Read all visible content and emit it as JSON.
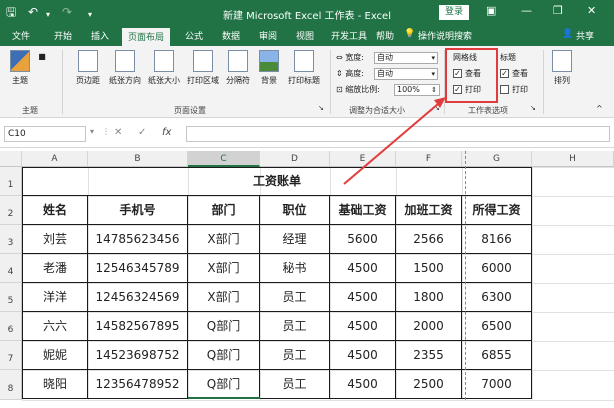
{
  "titlebar": {
    "title": "新建 Microsoft Excel 工作表 - Excel",
    "login": "登录",
    "min": "—",
    "restore": "❐",
    "close": "✕"
  },
  "tabs": [
    "文件",
    "开始",
    "插入",
    "页面布局",
    "公式",
    "数据",
    "审阅",
    "视图",
    "开发工具",
    "帮助"
  ],
  "tell_me": "操作说明搜索",
  "share": "共享",
  "ribbon": {
    "theme": {
      "themes": "主题",
      "group": "主题"
    },
    "page_setup": {
      "margins": "页边距",
      "orientation": "纸张方向",
      "size": "纸张大小",
      "print_area": "打印区域",
      "breaks": "分隔符",
      "background": "背景",
      "print_titles": "打印标题",
      "group": "页面设置"
    },
    "scale": {
      "width_label": "宽度:",
      "width_value": "自动",
      "height_label": "高度:",
      "height_value": "自动",
      "scale_label": "缩放比例:",
      "scale_value": "100%",
      "group": "调整为合适大小"
    },
    "sheet_options": {
      "gridlines": "网格线",
      "headings": "标题",
      "view": "查看",
      "print": "打印",
      "group": "工作表选项"
    },
    "arrange": {
      "label": "排列"
    }
  },
  "formula_bar": {
    "name_box": "C10",
    "cancel": "✕",
    "enter": "✓",
    "fx": "fx"
  },
  "columns": [
    "A",
    "B",
    "C",
    "D",
    "E",
    "F",
    "G",
    "H"
  ],
  "rows": [
    "1",
    "2",
    "3",
    "4",
    "5",
    "6",
    "7",
    "8"
  ],
  "sheet": {
    "title": "工资账单",
    "headers": [
      "姓名",
      "手机号",
      "部门",
      "职位",
      "基础工资",
      "加班工资",
      "所得工资"
    ],
    "data": [
      [
        "刘芸",
        "14785623456",
        "X部门",
        "经理",
        "5600",
        "2566",
        "8166"
      ],
      [
        "老潘",
        "12546345789",
        "X部门",
        "秘书",
        "4500",
        "1500",
        "6000"
      ],
      [
        "洋洋",
        "12456324569",
        "X部门",
        "员工",
        "4500",
        "1800",
        "6300"
      ],
      [
        "六六",
        "14582567895",
        "Q部门",
        "员工",
        "4500",
        "2000",
        "6500"
      ],
      [
        "妮妮",
        "14523698752",
        "Q部门",
        "员工",
        "4500",
        "2355",
        "6855"
      ],
      [
        "晓阳",
        "12356478952",
        "Q部门",
        "员工",
        "4500",
        "2500",
        "7000"
      ]
    ]
  },
  "colors": {
    "excel_green": "#217346",
    "highlight": "#e23b3b"
  }
}
